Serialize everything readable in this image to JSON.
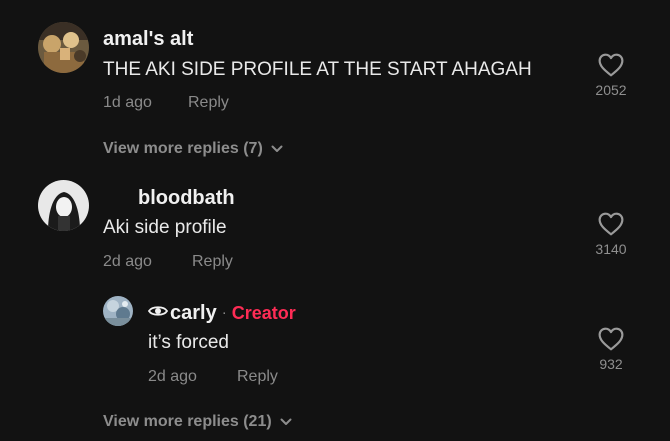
{
  "comments": [
    {
      "username": "amal's alt",
      "text": "THE AKI SIDE PROFILE AT THE START AHAGAH",
      "time": "1d ago",
      "reply_label": "Reply",
      "likes": "2052",
      "view_more": "View more replies (7)"
    },
    {
      "username": "bloodbath",
      "text": "Aki side profile",
      "time": "2d ago",
      "reply_label": "Reply",
      "likes": "3140"
    }
  ],
  "reply": {
    "username": "carly",
    "separator": "·",
    "badge": "Creator",
    "text": "it’s forced",
    "time": "2d ago",
    "reply_label": "Reply",
    "likes": "932"
  },
  "view_more_bottom": "View more replies (21)",
  "colors": {
    "background": "#121212",
    "creator": "#fe2c55",
    "muted": "#8a8a8a"
  }
}
